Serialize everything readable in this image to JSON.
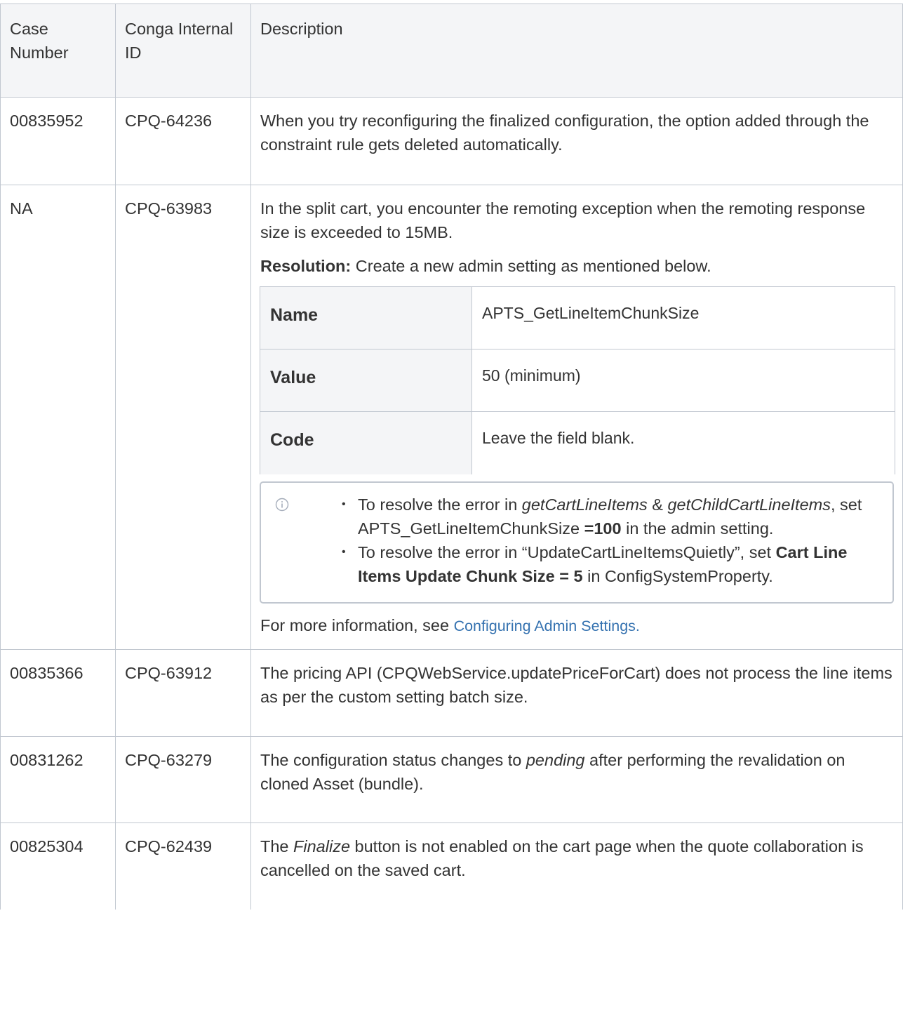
{
  "headers": {
    "case_number": "Case Number",
    "internal_id": "Conga Internal ID",
    "description": "Description"
  },
  "rows": [
    {
      "case": "00835952",
      "id": "CPQ-64236",
      "desc": "When you try reconfiguring the finalized configuration, the option added through the constraint rule gets deleted automatically."
    },
    {
      "case": "NA",
      "id": "CPQ-63983",
      "desc": "In the split cart, you encounter the remoting exception when the remoting response size is exceeded to 15MB.",
      "resolution_label": "Resolution:",
      "resolution_text": " Create a new admin setting as mentioned below.",
      "settings": [
        {
          "key": "Name",
          "value": "APTS_GetLineItemChunkSize"
        },
        {
          "key": "Value",
          "value": "50 (minimum)"
        },
        {
          "key": "Code",
          "value": "Leave the field blank."
        }
      ],
      "note": {
        "icon": "info-icon",
        "b1_pre": "To resolve the error in ",
        "b1_em1": "getCartLineItems",
        "b1_amp": " & ",
        "b1_em2": "getChildCartLineItems",
        "b1_mid": ", set APTS_GetLineItemChunkSize ",
        "b1_bold": "=100",
        "b1_post": " in the admin setting.",
        "b2_pre": "To resolve the error in “UpdateCartLineItemsQuietly”, set ",
        "b2_bold": "Cart Line Items Update Chunk Size = 5",
        "b2_post": " in ConfigSystemProperty."
      },
      "more_pre": "For more information, see ",
      "more_link": "Configuring Admin Settings."
    },
    {
      "case": "00835366",
      "id": "CPQ-63912",
      "desc": "The pricing API (CPQWebService.updatePriceForCart) does not process the line items as per the custom setting batch size."
    },
    {
      "case": "00831262",
      "id": "CPQ-63279",
      "desc_pre": "The configuration status changes to ",
      "desc_em": "pending",
      "desc_post": " after performing the revalidation on cloned Asset (bundle)."
    },
    {
      "case": "00825304",
      "id": "CPQ-62439",
      "desc_pre": "The ",
      "desc_em": "Finalize",
      "desc_post": " button is not enabled on the cart page when the quote collaboration is cancelled on the saved cart."
    }
  ]
}
